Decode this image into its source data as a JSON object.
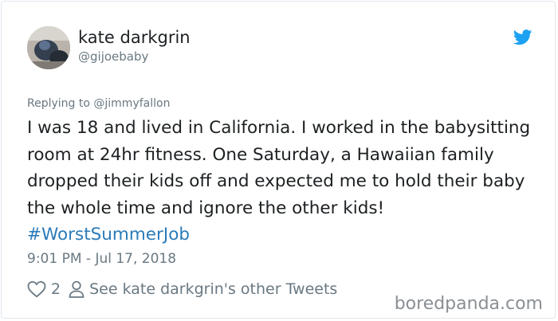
{
  "user": {
    "name": "kate darkgrin",
    "handle": "@gijoebaby"
  },
  "reply": {
    "prefix": "Replying to ",
    "mention": "@jimmyfallon"
  },
  "tweet": {
    "text": "I was 18 and lived in California. I worked in the babysitting room at 24hr fitness. One Saturday, a Hawaiian family dropped their kids off and expected me to hold their baby the whole time and ignore the other kids! ",
    "hashtag": "#WorstSummerJob",
    "timestamp": "9:01 PM - Jul 17, 2018"
  },
  "actions": {
    "like_count": "2",
    "other_tweets_label": "See kate darkgrin's other Tweets"
  },
  "watermark": "boredpanda.com",
  "colors": {
    "twitter_blue": "#1da1f2",
    "hashtag": "#2b7bb9",
    "secondary_text": "#697882",
    "primary_text": "#1c2022"
  },
  "icons": [
    "twitter-bird-icon",
    "heart-icon",
    "person-icon"
  ]
}
